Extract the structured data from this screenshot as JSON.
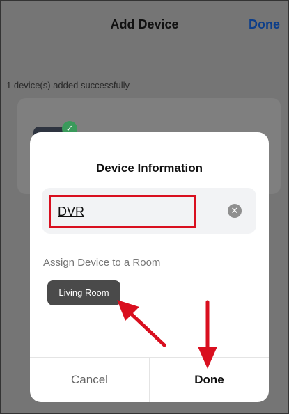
{
  "header": {
    "title": "Add Device",
    "done_label": "Done"
  },
  "status": {
    "success_text": "1 device(s) added successfully"
  },
  "device": {
    "icon": "dvr-device-icon",
    "badge_icon": "check-icon"
  },
  "dialog": {
    "title": "Device Information",
    "name_value": "DVR",
    "clear_icon": "clear-icon",
    "assign_label": "Assign Device to a Room",
    "room_chip": "Living Room",
    "cancel_label": "Cancel",
    "done_label": "Done"
  },
  "colors": {
    "overlay": "#757575",
    "annotation_red": "#d90f1f",
    "link_blue": "#0c3e8a",
    "chip_bg": "#4a4a4a",
    "success_green": "#3a9a5b"
  }
}
